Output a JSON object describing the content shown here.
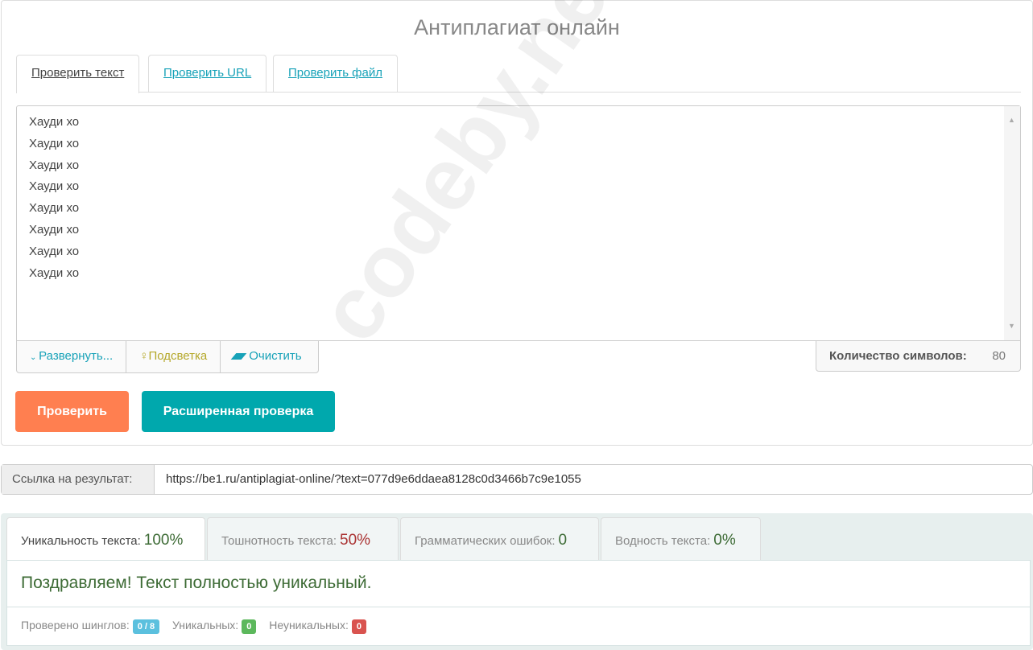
{
  "title": "Антиплагиат онлайн",
  "tabs": [
    "Проверить текст",
    "Проверить URL",
    "Проверить файл"
  ],
  "text_lines": [
    "Хауди хо",
    "Хауди хо",
    "Хауди хо",
    "Хауди хо",
    "Хауди хо",
    "Хауди хо",
    "Хауди хо",
    "Хауди хо"
  ],
  "tools": {
    "expand": "Развернуть...",
    "highlight": "Подсветка",
    "clear": "Очистить"
  },
  "count": {
    "label": "Количество символов:",
    "value": "80"
  },
  "buttons": {
    "check": "Проверить",
    "advanced": "Расширенная проверка"
  },
  "watermark": "codeby.net",
  "link": {
    "label": "Ссылка на результат:",
    "value": "https://be1.ru/antiplagiat-online/?text=077d9e6ddaea8128c0d3466b7c9e1055"
  },
  "results": {
    "tabs": [
      {
        "label": "Уникальность текста:",
        "value": "100%"
      },
      {
        "label": "Тошнотность текста:",
        "value": "50%"
      },
      {
        "label": "Грамматических ошибок:",
        "value": "0"
      },
      {
        "label": "Водность текста:",
        "value": "0%"
      }
    ],
    "message": "Поздравляем! Текст полностью уникальный.",
    "shingles_label": "Проверено шинглов:",
    "shingles": "0 / 8",
    "unique_label": "Уникальных:",
    "unique": "0",
    "nonunique_label": "Неуникальных:",
    "nonunique": "0"
  },
  "colors": {
    "orange": "#ff7f50",
    "teal": "#00a8ad",
    "green": "#3d6b35",
    "red": "#a33"
  }
}
